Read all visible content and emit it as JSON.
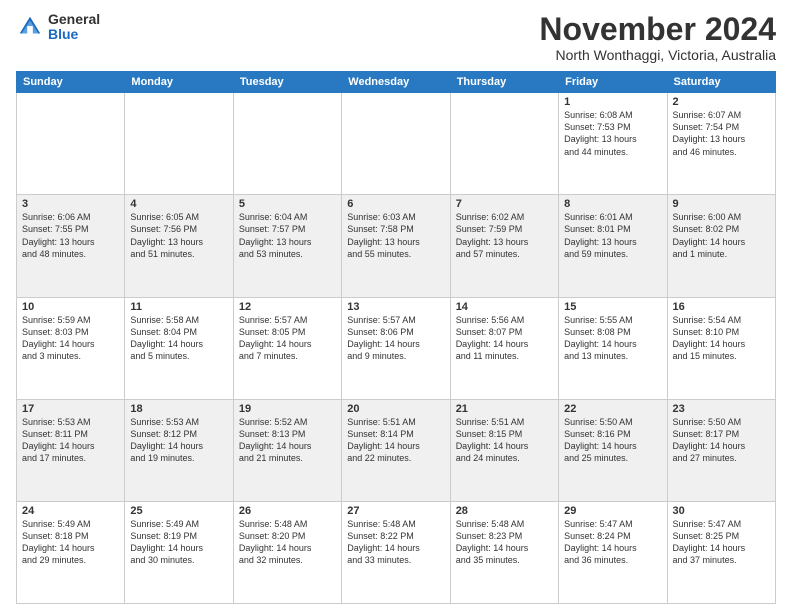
{
  "header": {
    "logo_general": "General",
    "logo_blue": "Blue",
    "month_title": "November 2024",
    "location": "North Wonthaggi, Victoria, Australia"
  },
  "days_of_week": [
    "Sunday",
    "Monday",
    "Tuesday",
    "Wednesday",
    "Thursday",
    "Friday",
    "Saturday"
  ],
  "weeks": [
    [
      {
        "day": "",
        "info": ""
      },
      {
        "day": "",
        "info": ""
      },
      {
        "day": "",
        "info": ""
      },
      {
        "day": "",
        "info": ""
      },
      {
        "day": "",
        "info": ""
      },
      {
        "day": "1",
        "info": "Sunrise: 6:08 AM\nSunset: 7:53 PM\nDaylight: 13 hours\nand 44 minutes."
      },
      {
        "day": "2",
        "info": "Sunrise: 6:07 AM\nSunset: 7:54 PM\nDaylight: 13 hours\nand 46 minutes."
      }
    ],
    [
      {
        "day": "3",
        "info": "Sunrise: 6:06 AM\nSunset: 7:55 PM\nDaylight: 13 hours\nand 48 minutes."
      },
      {
        "day": "4",
        "info": "Sunrise: 6:05 AM\nSunset: 7:56 PM\nDaylight: 13 hours\nand 51 minutes."
      },
      {
        "day": "5",
        "info": "Sunrise: 6:04 AM\nSunset: 7:57 PM\nDaylight: 13 hours\nand 53 minutes."
      },
      {
        "day": "6",
        "info": "Sunrise: 6:03 AM\nSunset: 7:58 PM\nDaylight: 13 hours\nand 55 minutes."
      },
      {
        "day": "7",
        "info": "Sunrise: 6:02 AM\nSunset: 7:59 PM\nDaylight: 13 hours\nand 57 minutes."
      },
      {
        "day": "8",
        "info": "Sunrise: 6:01 AM\nSunset: 8:01 PM\nDaylight: 13 hours\nand 59 minutes."
      },
      {
        "day": "9",
        "info": "Sunrise: 6:00 AM\nSunset: 8:02 PM\nDaylight: 14 hours\nand 1 minute."
      }
    ],
    [
      {
        "day": "10",
        "info": "Sunrise: 5:59 AM\nSunset: 8:03 PM\nDaylight: 14 hours\nand 3 minutes."
      },
      {
        "day": "11",
        "info": "Sunrise: 5:58 AM\nSunset: 8:04 PM\nDaylight: 14 hours\nand 5 minutes."
      },
      {
        "day": "12",
        "info": "Sunrise: 5:57 AM\nSunset: 8:05 PM\nDaylight: 14 hours\nand 7 minutes."
      },
      {
        "day": "13",
        "info": "Sunrise: 5:57 AM\nSunset: 8:06 PM\nDaylight: 14 hours\nand 9 minutes."
      },
      {
        "day": "14",
        "info": "Sunrise: 5:56 AM\nSunset: 8:07 PM\nDaylight: 14 hours\nand 11 minutes."
      },
      {
        "day": "15",
        "info": "Sunrise: 5:55 AM\nSunset: 8:08 PM\nDaylight: 14 hours\nand 13 minutes."
      },
      {
        "day": "16",
        "info": "Sunrise: 5:54 AM\nSunset: 8:10 PM\nDaylight: 14 hours\nand 15 minutes."
      }
    ],
    [
      {
        "day": "17",
        "info": "Sunrise: 5:53 AM\nSunset: 8:11 PM\nDaylight: 14 hours\nand 17 minutes."
      },
      {
        "day": "18",
        "info": "Sunrise: 5:53 AM\nSunset: 8:12 PM\nDaylight: 14 hours\nand 19 minutes."
      },
      {
        "day": "19",
        "info": "Sunrise: 5:52 AM\nSunset: 8:13 PM\nDaylight: 14 hours\nand 21 minutes."
      },
      {
        "day": "20",
        "info": "Sunrise: 5:51 AM\nSunset: 8:14 PM\nDaylight: 14 hours\nand 22 minutes."
      },
      {
        "day": "21",
        "info": "Sunrise: 5:51 AM\nSunset: 8:15 PM\nDaylight: 14 hours\nand 24 minutes."
      },
      {
        "day": "22",
        "info": "Sunrise: 5:50 AM\nSunset: 8:16 PM\nDaylight: 14 hours\nand 25 minutes."
      },
      {
        "day": "23",
        "info": "Sunrise: 5:50 AM\nSunset: 8:17 PM\nDaylight: 14 hours\nand 27 minutes."
      }
    ],
    [
      {
        "day": "24",
        "info": "Sunrise: 5:49 AM\nSunset: 8:18 PM\nDaylight: 14 hours\nand 29 minutes."
      },
      {
        "day": "25",
        "info": "Sunrise: 5:49 AM\nSunset: 8:19 PM\nDaylight: 14 hours\nand 30 minutes."
      },
      {
        "day": "26",
        "info": "Sunrise: 5:48 AM\nSunset: 8:20 PM\nDaylight: 14 hours\nand 32 minutes."
      },
      {
        "day": "27",
        "info": "Sunrise: 5:48 AM\nSunset: 8:22 PM\nDaylight: 14 hours\nand 33 minutes."
      },
      {
        "day": "28",
        "info": "Sunrise: 5:48 AM\nSunset: 8:23 PM\nDaylight: 14 hours\nand 35 minutes."
      },
      {
        "day": "29",
        "info": "Sunrise: 5:47 AM\nSunset: 8:24 PM\nDaylight: 14 hours\nand 36 minutes."
      },
      {
        "day": "30",
        "info": "Sunrise: 5:47 AM\nSunset: 8:25 PM\nDaylight: 14 hours\nand 37 minutes."
      }
    ]
  ]
}
